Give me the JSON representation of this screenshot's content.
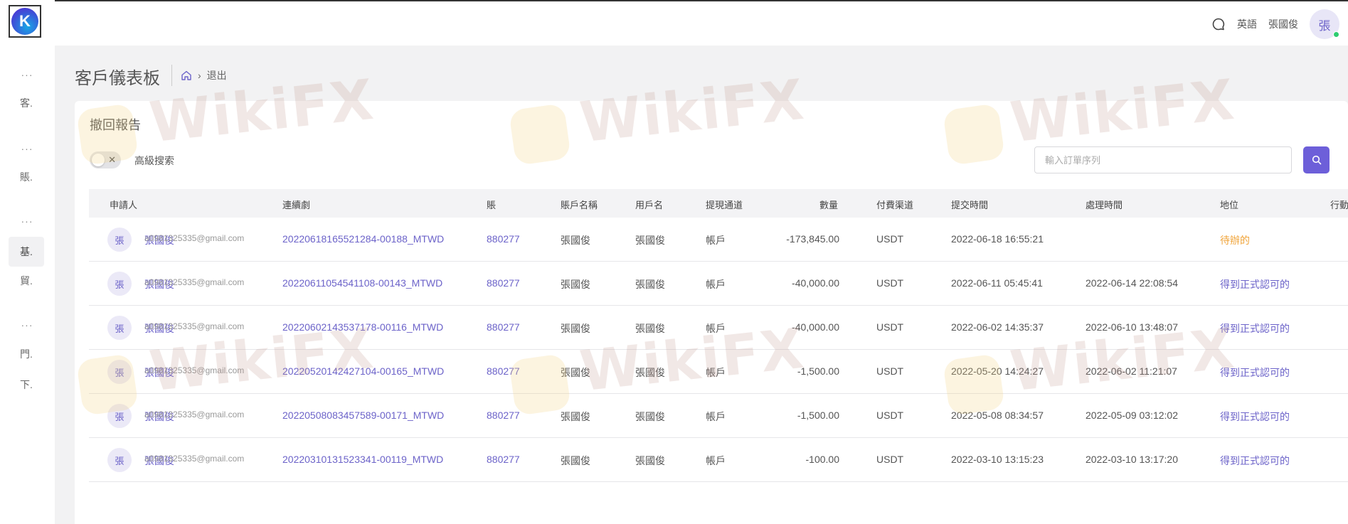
{
  "sidebar": {
    "logo_letter": "K",
    "items": [
      {
        "label": "客."
      },
      {
        "label": "賬."
      },
      {
        "label": "基."
      },
      {
        "label": "貿."
      },
      {
        "label": "門."
      },
      {
        "label": "下."
      }
    ],
    "more_glyph": "···"
  },
  "topbar": {
    "language": "英語",
    "username": "張國俊",
    "avatar_initial": "張"
  },
  "page": {
    "title": "客戶儀表板",
    "breadcrumb_current": "退出"
  },
  "card": {
    "title": "撤回報告",
    "advanced_search_label": "高級搜索",
    "toggle_glyph": "✕",
    "search_placeholder": "輸入訂單序列"
  },
  "table": {
    "headers": [
      "申請人",
      "連續劇",
      "賬",
      "賬戶名稱",
      "用戶名",
      "提現通道",
      "數量",
      "付費渠道",
      "提交時間",
      "處理時間",
      "地位",
      "行動"
    ],
    "rows": [
      {
        "initial": "張",
        "name": "張國俊",
        "email": "a0981325335@gmail.com",
        "serial": "20220618165521284-00188_MTWD",
        "account": "880277",
        "account_name": "張國俊",
        "username": "張國俊",
        "channel": "帳戶",
        "amount": "-173,845.00",
        "pay_channel": "USDT",
        "submitted": "2022-06-18 16:55:21",
        "processed": "",
        "status": "待辦的",
        "status_type": "pending"
      },
      {
        "initial": "張",
        "name": "張國俊",
        "email": "a0981325335@gmail.com",
        "serial": "20220611054541108-00143_MTWD",
        "account": "880277",
        "account_name": "張國俊",
        "username": "張國俊",
        "channel": "帳戶",
        "amount": "-40,000.00",
        "pay_channel": "USDT",
        "submitted": "2022-06-11 05:45:41",
        "processed": "2022-06-14 22:08:54",
        "status": "得到正式認可的",
        "status_type": "ok"
      },
      {
        "initial": "張",
        "name": "張國俊",
        "email": "a0981325335@gmail.com",
        "serial": "20220602143537178-00116_MTWD",
        "account": "880277",
        "account_name": "張國俊",
        "username": "張國俊",
        "channel": "帳戶",
        "amount": "-40,000.00",
        "pay_channel": "USDT",
        "submitted": "2022-06-02 14:35:37",
        "processed": "2022-06-10 13:48:07",
        "status": "得到正式認可的",
        "status_type": "ok"
      },
      {
        "initial": "張",
        "name": "張國俊",
        "email": "a0981325335@gmail.com",
        "serial": "20220520142427104-00165_MTWD",
        "account": "880277",
        "account_name": "張國俊",
        "username": "張國俊",
        "channel": "帳戶",
        "amount": "-1,500.00",
        "pay_channel": "USDT",
        "submitted": "2022-05-20 14:24:27",
        "processed": "2022-06-02 11:21:07",
        "status": "得到正式認可的",
        "status_type": "ok"
      },
      {
        "initial": "張",
        "name": "張國俊",
        "email": "a0981325335@gmail.com",
        "serial": "20220508083457589-00171_MTWD",
        "account": "880277",
        "account_name": "張國俊",
        "username": "張國俊",
        "channel": "帳戶",
        "amount": "-1,500.00",
        "pay_channel": "USDT",
        "submitted": "2022-05-08 08:34:57",
        "processed": "2022-05-09 03:12:02",
        "status": "得到正式認可的",
        "status_type": "ok"
      },
      {
        "initial": "張",
        "name": "張國俊",
        "email": "a0981325335@gmail.com",
        "serial": "20220310131523341-00119_MTWD",
        "account": "880277",
        "account_name": "張國俊",
        "username": "張國俊",
        "channel": "帳戶",
        "amount": "-100.00",
        "pay_channel": "USDT",
        "submitted": "2022-03-10 13:15:23",
        "processed": "2022-03-10 13:17:20",
        "status": "得到正式認可的",
        "status_type": "ok"
      }
    ]
  },
  "watermark": {
    "text": "WikiFX"
  },
  "colors": {
    "accent": "#6d5fd9",
    "link": "#6c63c9",
    "pending": "#f0a43a",
    "online": "#2ecc71"
  }
}
